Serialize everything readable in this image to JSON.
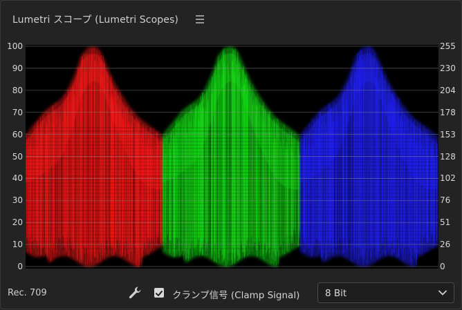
{
  "panel": {
    "title": "Lumetri スコープ (Lumetri Scopes)",
    "menu_icon": "hamburger-menu-icon"
  },
  "scope": {
    "type": "RGB parade waveform",
    "left_ticks": [
      "100",
      "90",
      "80",
      "70",
      "60",
      "50",
      "40",
      "30",
      "20",
      "10",
      "0"
    ],
    "right_ticks": [
      "255",
      "230",
      "204",
      "178",
      "153",
      "128",
      "102",
      "76",
      "51",
      "26",
      "0"
    ],
    "channels": [
      {
        "name": "red",
        "color": "#ff1a1a"
      },
      {
        "name": "green",
        "color": "#19e019"
      },
      {
        "name": "blue",
        "color": "#2424ff"
      }
    ]
  },
  "footer": {
    "color_space": "Rec. 709",
    "wrench_icon": "wrench-icon",
    "clamp_checked": true,
    "clamp_label": "クランプ信号 (Clamp Signal)",
    "bit_depth": "8 Bit",
    "dropdown_icon": "chevron-down-icon"
  }
}
